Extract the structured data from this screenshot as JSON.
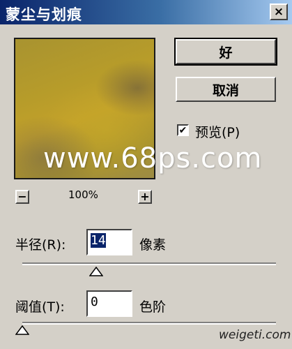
{
  "dialog": {
    "title": "蒙尘与划痕",
    "close_glyph": "×"
  },
  "preview": {
    "zoom_out_glyph": "−",
    "zoom_in_glyph": "+",
    "zoom_level": "100%",
    "watermark": "www.68ps.com"
  },
  "buttons": {
    "ok": "好",
    "cancel": "取消"
  },
  "preview_toggle": {
    "label": "预览(P)",
    "checked_glyph": "✔"
  },
  "radius": {
    "label": "半径(R):",
    "value": "14",
    "unit": "像素",
    "slider_fraction": 0.29
  },
  "threshold": {
    "label": "阈值(T):",
    "value": "0",
    "unit": "色阶",
    "slider_fraction": 0.0
  },
  "footer_watermark": "weigeti.com"
}
